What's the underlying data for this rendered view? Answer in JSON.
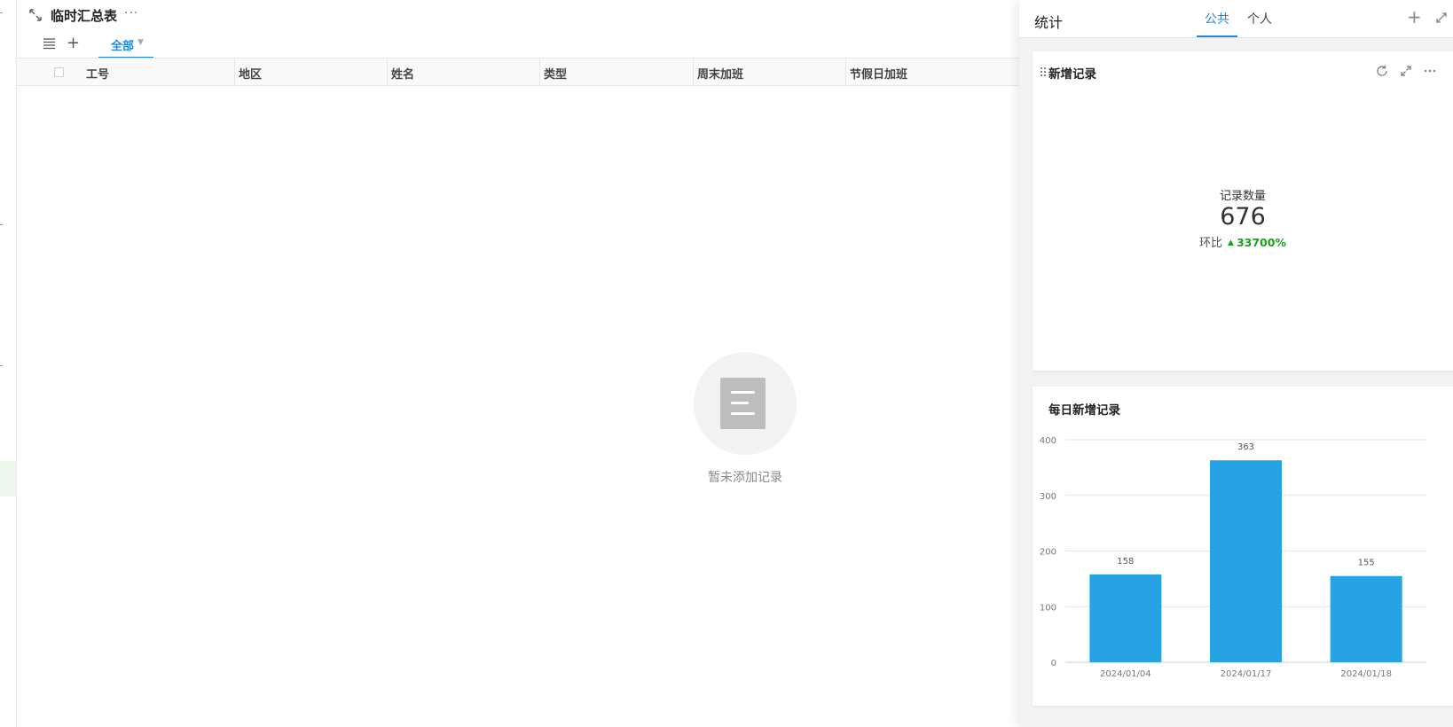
{
  "sheet": {
    "title": "临时汇总表",
    "more": "···"
  },
  "views": {
    "active_tab": "全部"
  },
  "grid": {
    "columns": [
      "工号",
      "地区",
      "姓名",
      "类型",
      "周末加班",
      "节假日加班"
    ]
  },
  "empty_state": {
    "message": "暂未添加记录"
  },
  "panel": {
    "title": "统计",
    "tabs": [
      "公共",
      "个人"
    ],
    "active_tab_index": 0,
    "accent": "#1e88e5"
  },
  "card_new": {
    "title": "新增记录",
    "metric_label": "记录数量",
    "metric_value": "676",
    "compare_label": "环比",
    "compare_value": "33700%",
    "compare_direction": "up",
    "compare_color": "#1aa31a"
  },
  "card_daily": {
    "title": "每日新增记录"
  },
  "chart_data": {
    "type": "bar",
    "categories": [
      "2024/01/04",
      "2024/01/17",
      "2024/01/18"
    ],
    "values": [
      158,
      363,
      155
    ],
    "data_labels": [
      "158",
      "363",
      "155"
    ],
    "yticks": [
      "0",
      "100",
      "200",
      "300",
      "400"
    ],
    "ylim": [
      0,
      400
    ],
    "grid": true,
    "bar_color": "#27a3e4"
  }
}
